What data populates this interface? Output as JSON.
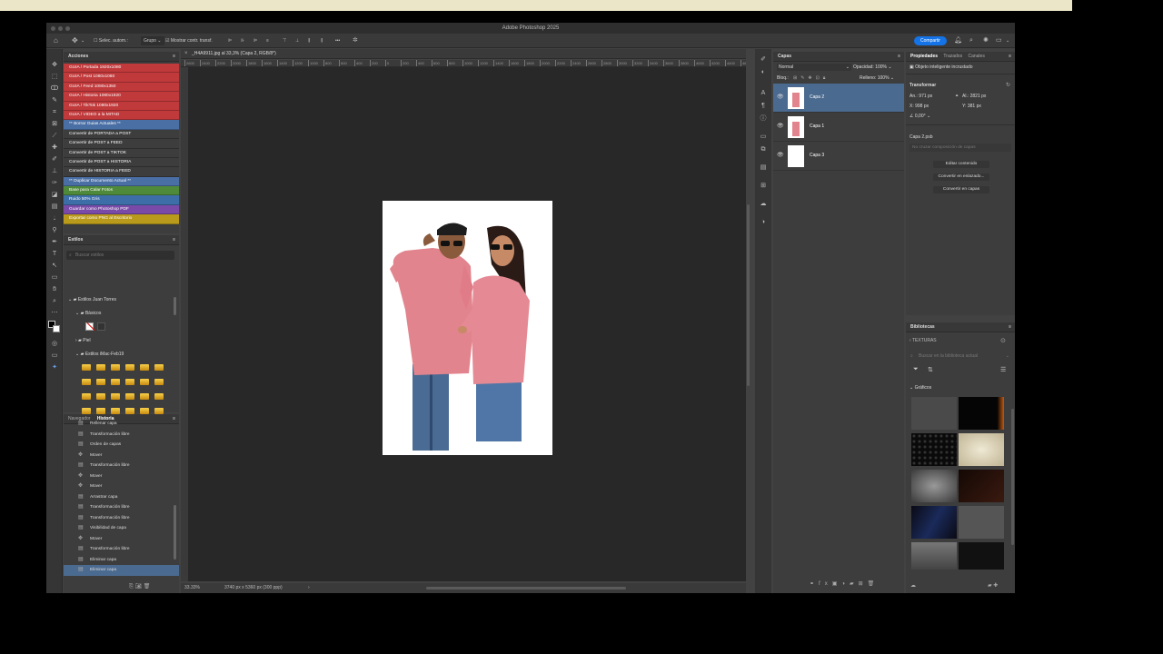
{
  "window": {
    "title": "Adobe Photoshop 2025"
  },
  "options_bar": {
    "auto_select": "Selec. autom.:",
    "group": "Grupo",
    "show_transform": "Mostrar contr. transf.",
    "more": "•••",
    "share": "Compartir"
  },
  "acciones": {
    "title": "Acciones",
    "items": [
      {
        "label": "GUIA / Portada 1920x1080",
        "color": "#c0393b"
      },
      {
        "label": "GUIA / Post 1080x1080",
        "color": "#c0393b"
      },
      {
        "label": "GUIA / Feed 1080x1350",
        "color": "#c0393b"
      },
      {
        "label": "GUIA / Historia 1080x1920",
        "color": "#c0393b"
      },
      {
        "label": "GUIA / TikTok 1080x1920",
        "color": "#c0393b"
      },
      {
        "label": "GUIA / VIDEO a la MITAD",
        "color": "#c0393b"
      },
      {
        "label": "** Borrar Guias Actuales **",
        "color": "#4a6fa5"
      },
      {
        "label": "Convertir de PORTADA a POST",
        "color": "#3d3d3d"
      },
      {
        "label": "Convertir de POST a FEED",
        "color": "#3d3d3d"
      },
      {
        "label": "Convertir de POST a TIKTOK",
        "color": "#3d3d3d"
      },
      {
        "label": "Convertir de POST a HISTORIA",
        "color": "#3d3d3d"
      },
      {
        "label": "Convertir de  HISTORIA a FEED",
        "color": "#3d3d3d"
      },
      {
        "label": "** Duplicar Documento Actual **",
        "color": "#4a6fa5"
      },
      {
        "label": "Base para Calar Fotos",
        "color": "#4f8a3a"
      },
      {
        "label": "Ruido 50% Gris",
        "color": "#3d6ea8"
      },
      {
        "label": "Guardar como Photoshop PDF",
        "color": "#7a4aa8"
      },
      {
        "label": "Exportar como PNG al Escritorio",
        "color": "#b99a1b"
      }
    ]
  },
  "estilos": {
    "title": "Estilos",
    "search_placeholder": "Buscar estilos",
    "groups": [
      "Estilos Juan Torres",
      "Básicos",
      "Piel",
      "Estilos iMac-Feb19"
    ]
  },
  "historia": {
    "tabs": [
      "Navegador",
      "Historia"
    ],
    "items": [
      "Rellenar capa",
      "Transformación libre",
      "Orden de capas",
      "Mover",
      "Transformación libre",
      "Mover",
      "Mover",
      "Arrastrar capa",
      "Transformación libre",
      "Transformación libre",
      "Visibilidad de capa",
      "Mover",
      "Transformación libre",
      "Eliminar capa",
      "Eliminar capa"
    ]
  },
  "document": {
    "tab": "_H4A9911.jpg al 33,3% (Capa 2, RGB/8*)",
    "zoom": "33.33%",
    "info": "3740 px x 5360 px (300 ppp)"
  },
  "ruler_ticks": [
    "2600",
    "2400",
    "2200",
    "2000",
    "1800",
    "1600",
    "1400",
    "1200",
    "1000",
    "800",
    "600",
    "400",
    "200",
    "0",
    "200",
    "400",
    "600",
    "800",
    "1000",
    "1200",
    "1400",
    "1600",
    "1800",
    "2000",
    "2200",
    "2400",
    "2600",
    "2800",
    "3000",
    "3200",
    "3400",
    "3600",
    "3800",
    "4000",
    "4200",
    "4400",
    "4600",
    "4800",
    "5000",
    "5200",
    "5400",
    "5600"
  ],
  "capas": {
    "title": "Capas",
    "blend": "Normal",
    "opacity_label": "Opacidad:",
    "opacity": "100%",
    "lock_label": "Bloq.:",
    "fill_label": "Relleno:",
    "fill": "100%",
    "layers": [
      "Capa 2",
      "Capa 1",
      "Capa 3"
    ]
  },
  "propiedades": {
    "tabs": [
      "Propiedades",
      "Trazados",
      "Canales"
    ],
    "object": "Objeto inteligente incrustado",
    "transform": "Transformar",
    "an_label": "An.:",
    "an": "971 px",
    "al_label": "Al.:",
    "al": "2821 px",
    "x_label": "X:",
    "x": "998 px",
    "y_label": "Y:",
    "y": "381 px",
    "angle": "0,00°",
    "psb": "Capa 2.psb",
    "comp_placeholder": "No cruzar composición de capas",
    "buttons": [
      "Editar contenido",
      "Convertir en enlazado...",
      "Convertir en capas"
    ]
  },
  "bibliotecas": {
    "title": "Bibliotecas",
    "library": "TEXTURAS",
    "search_placeholder": "Buscar en la biblioteca actual",
    "section": "Gráficos"
  },
  "colors": {
    "accent": "#1473e6",
    "selected": "#4b6a8f"
  }
}
